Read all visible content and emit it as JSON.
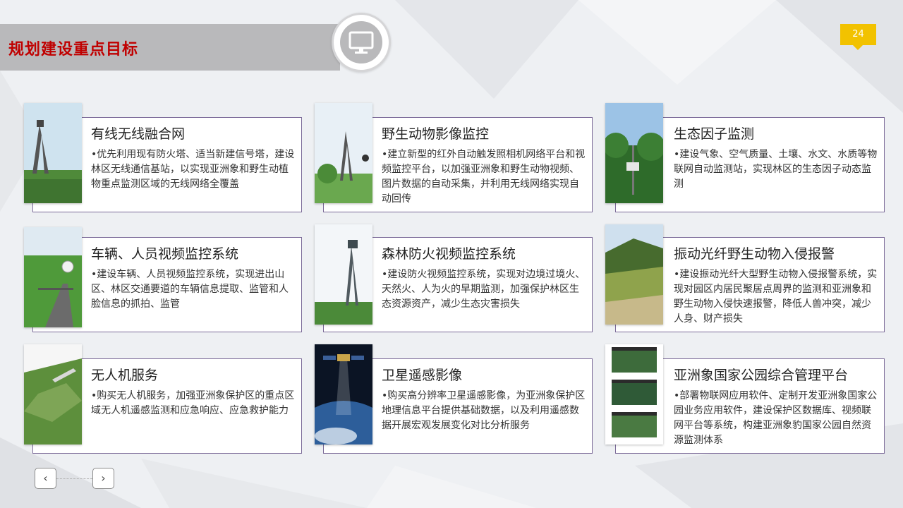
{
  "header": {
    "title": "规划建设重点目标",
    "icon": "monitor-icon"
  },
  "page_number": "24",
  "cards": [
    {
      "title": "有线无线融合网",
      "text": "•优先利用现有防火塔、适当新建信号塔，建设林区无线通信基站，以实现亚洲象和野生动植物重点监测区域的无线网络全覆盖",
      "image": "tower-in-forest-photo"
    },
    {
      "title": "野生动物影像监控",
      "text": "•建立新型的红外自动触发照相机网络平台和视频监控平台，以加强亚洲象和野生动物视频、图片数据的自动采集，并利用无线网络实现自动回传",
      "image": "camera-tower-photo"
    },
    {
      "title": "生态因子监测",
      "text": "•建设气象、空气质量、土壤、水文、水质等物联网自动监测站，实现林区的生态因子动态监测",
      "image": "monitoring-station-photo"
    },
    {
      "title": "车辆、人员视频监控系统",
      "text": "•建设车辆、人员视频监控系统，实现进出山区、林区交通要道的车辆信息提取、监管和人脸信息的抓拍、监管",
      "image": "road-camera-photo"
    },
    {
      "title": "森林防火视频监控系统",
      "text": "•建设防火视频监控系统，实现对边境过境火、天然火、人为火的早期监测，加强保护林区生态资源资产，减少生态灾害损失",
      "image": "fire-watch-tower-photo"
    },
    {
      "title": "振动光纤野生动物入侵报警",
      "text": "•建设振动光纤大型野生动物入侵报警系统，实现对园区内居民聚居点周界的监测和亚洲象和野生动物入侵快速报警，降低人兽冲突，减少人身、财产损失",
      "image": "elephants-hillside-photo"
    },
    {
      "title": "无人机服务",
      "text": "•购买无人机服务，加强亚洲象保护区的重点区域无人机遥感监测和应急响应、应急救护能力",
      "image": "drone-terrain-photo"
    },
    {
      "title": "卫星遥感影像",
      "text": "•购买高分辨率卫星遥感影像，为亚洲象保护区地理信息平台提供基础数据，以及利用遥感数据开展宏观发展变化对比分析服务",
      "image": "satellite-earth-photo"
    },
    {
      "title": "亚洲象国家公园综合管理平台",
      "text": "•部署物联网应用软件、定制开发亚洲象国家公园业务应用软件，建设保护区数据库、视频联网平台等系统，构建亚洲象豹国家公园自然资源监测体系",
      "image": "platform-screens-photo"
    }
  ],
  "nav": {
    "prev": "‹",
    "next": "›"
  },
  "colors": {
    "title_red": "#c00000",
    "badge_yellow": "#f2c200",
    "card_border": "#7b6a98"
  }
}
